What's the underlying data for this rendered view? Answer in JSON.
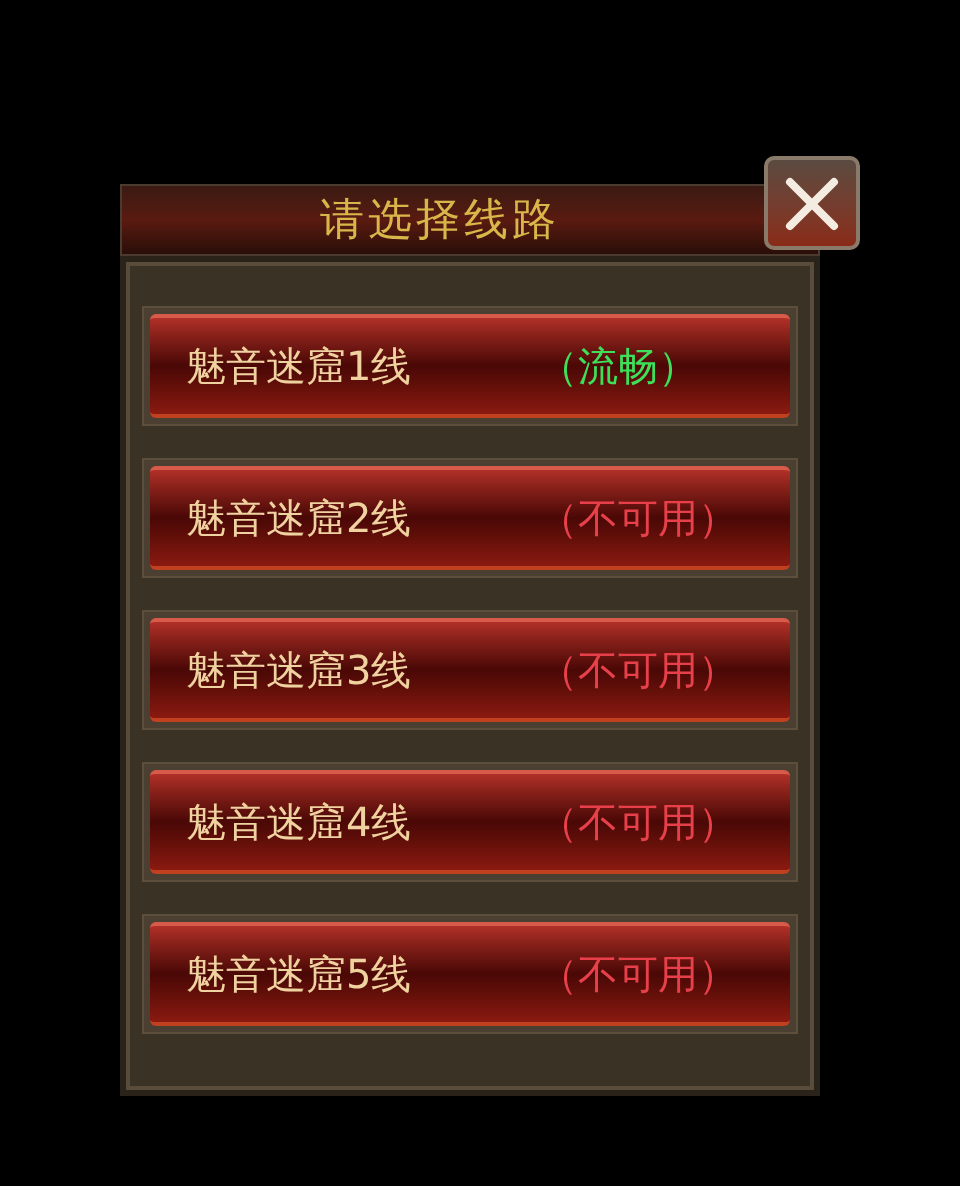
{
  "dialog": {
    "title": "请选择线路"
  },
  "lines": [
    {
      "name": "魅音迷窟1线",
      "status": "（流畅）",
      "kind": "available"
    },
    {
      "name": "魅音迷窟2线",
      "status": "（不可用）",
      "kind": "unavailable"
    },
    {
      "name": "魅音迷窟3线",
      "status": "（不可用）",
      "kind": "unavailable"
    },
    {
      "name": "魅音迷窟4线",
      "status": "（不可用）",
      "kind": "unavailable"
    },
    {
      "name": "魅音迷窟5线",
      "status": "（不可用）",
      "kind": "unavailable"
    }
  ]
}
